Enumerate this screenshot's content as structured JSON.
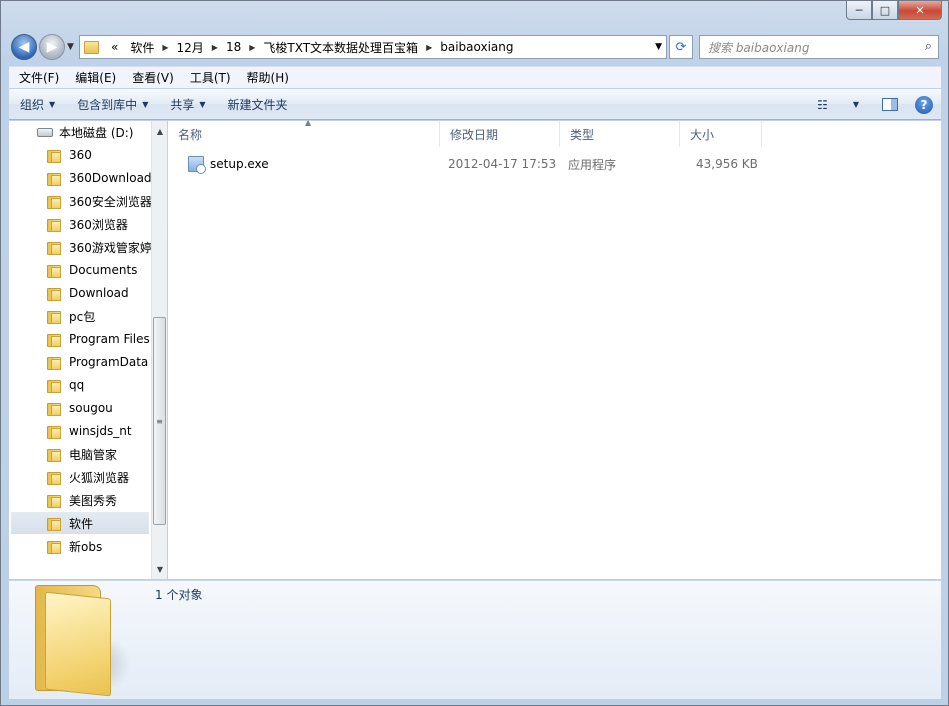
{
  "window": {
    "caption_buttons": {
      "minimize": "─",
      "maximize": "□",
      "close": "✕"
    }
  },
  "address_bar": {
    "overflow": "«",
    "crumbs": [
      "软件",
      "12月",
      "18",
      "飞梭TXT文本数据处理百宝箱",
      "baibaoxiang"
    ]
  },
  "search": {
    "placeholder": "搜索 baibaoxiang"
  },
  "menu": {
    "items": [
      "文件(F)",
      "编辑(E)",
      "查看(V)",
      "工具(T)",
      "帮助(H)"
    ]
  },
  "toolbar": {
    "organize": "组织",
    "include_in_library": "包含到库中",
    "share": "共享",
    "new_folder": "新建文件夹",
    "help": "?"
  },
  "navigation": {
    "root": "本地磁盘 (D:)",
    "folders": [
      "360",
      "360Download",
      "360安全浏览器",
      "360浏览器",
      "360游戏管家婷",
      "Documents",
      "Download",
      "pc包",
      "Program Files",
      "ProgramData",
      "qq",
      "sougou",
      "winsjds_nt",
      "电脑管家",
      "火狐浏览器",
      "美图秀秀",
      "软件",
      "新obs"
    ],
    "selected": "软件"
  },
  "columns": {
    "name": "名称",
    "modified": "修改日期",
    "type": "类型",
    "size": "大小"
  },
  "files": [
    {
      "name": "setup.exe",
      "modified": "2012-04-17 17:53",
      "type": "应用程序",
      "size": "43,956 KB"
    }
  ],
  "details_pane": {
    "count": "1 个对象"
  }
}
